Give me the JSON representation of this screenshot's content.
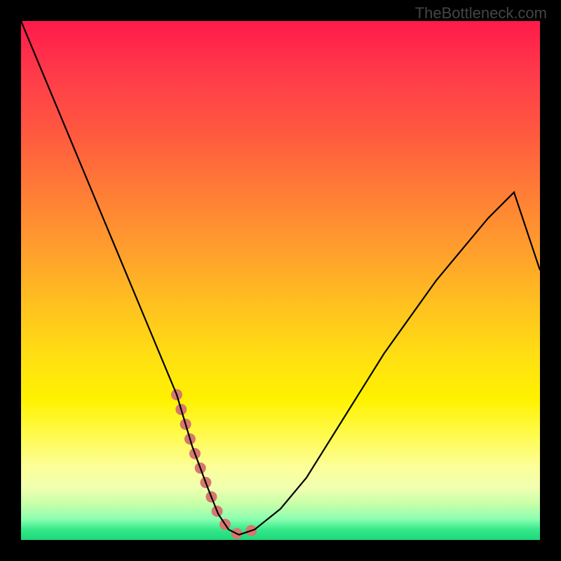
{
  "watermark": "TheBottleneck.com",
  "chart_data": {
    "type": "line",
    "title": "",
    "xlabel": "",
    "ylabel": "",
    "xlim": [
      0,
      100
    ],
    "ylim": [
      0,
      100
    ],
    "grid": false,
    "legend": false,
    "annotations": [],
    "series": [
      {
        "name": "bottleneck-curve",
        "x": [
          0,
          5,
          10,
          15,
          20,
          25,
          30,
          33,
          36,
          38,
          40,
          42,
          45,
          50,
          55,
          60,
          65,
          70,
          75,
          80,
          85,
          90,
          95,
          100
        ],
        "y": [
          100,
          88,
          76,
          64,
          52,
          40,
          28,
          18,
          10,
          5,
          2,
          1,
          2,
          6,
          12,
          20,
          28,
          36,
          43,
          50,
          56,
          62,
          67,
          52
        ]
      }
    ],
    "highlight_region": {
      "name": "optimal-range",
      "x": [
        30,
        33,
        36,
        38,
        40,
        42,
        45
      ],
      "y": [
        28,
        18,
        10,
        5,
        2,
        1,
        2
      ]
    },
    "background": {
      "type": "vertical-gradient",
      "stops": [
        {
          "pos": 0,
          "color": "#ff1a4a"
        },
        {
          "pos": 50,
          "color": "#ffd012"
        },
        {
          "pos": 85,
          "color": "#fffb50"
        },
        {
          "pos": 100,
          "color": "#1cd87a"
        }
      ]
    }
  }
}
